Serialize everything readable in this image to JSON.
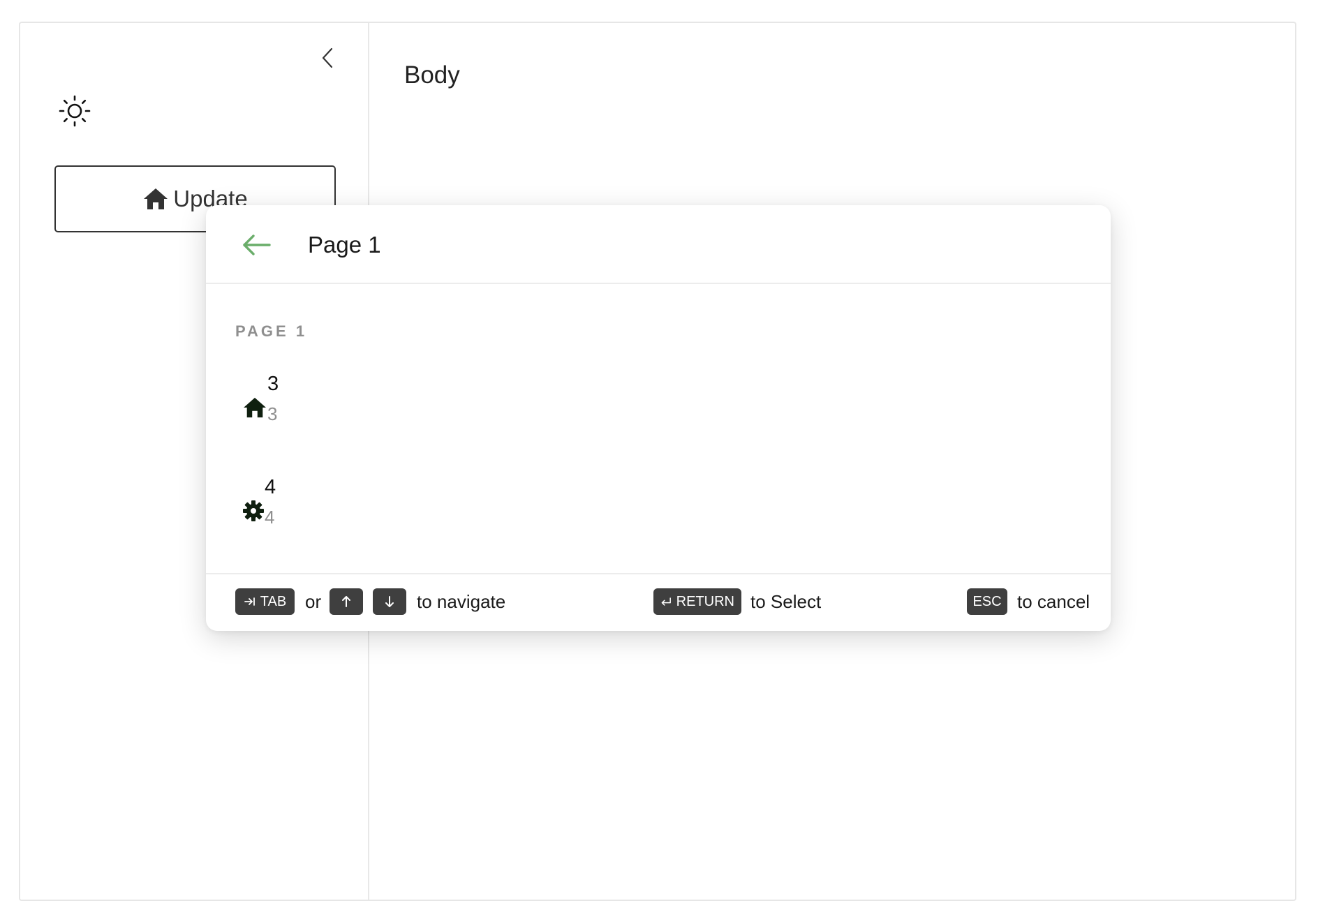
{
  "sidebar": {
    "collapse_icon": "chevron-left-icon",
    "theme_icon": "sun-icon",
    "update_button": {
      "icon": "home-icon",
      "label": "Update"
    }
  },
  "main": {
    "title": "Body"
  },
  "palette": {
    "back_icon": "arrow-left-icon",
    "accent_color": "#6aad6a",
    "title": "Page 1",
    "section_heading": "PAGE 1",
    "items": [
      {
        "icon": "home-icon",
        "title": "3",
        "subtitle": "3"
      },
      {
        "icon": "gear-icon",
        "title": "4",
        "subtitle": "4"
      }
    ],
    "footer": {
      "tab_key": "TAB",
      "or_text": "or",
      "navigate_text": "to navigate",
      "return_key": "RETURN",
      "select_text": "to Select",
      "esc_key": "ESC",
      "cancel_text": "to cancel"
    }
  }
}
